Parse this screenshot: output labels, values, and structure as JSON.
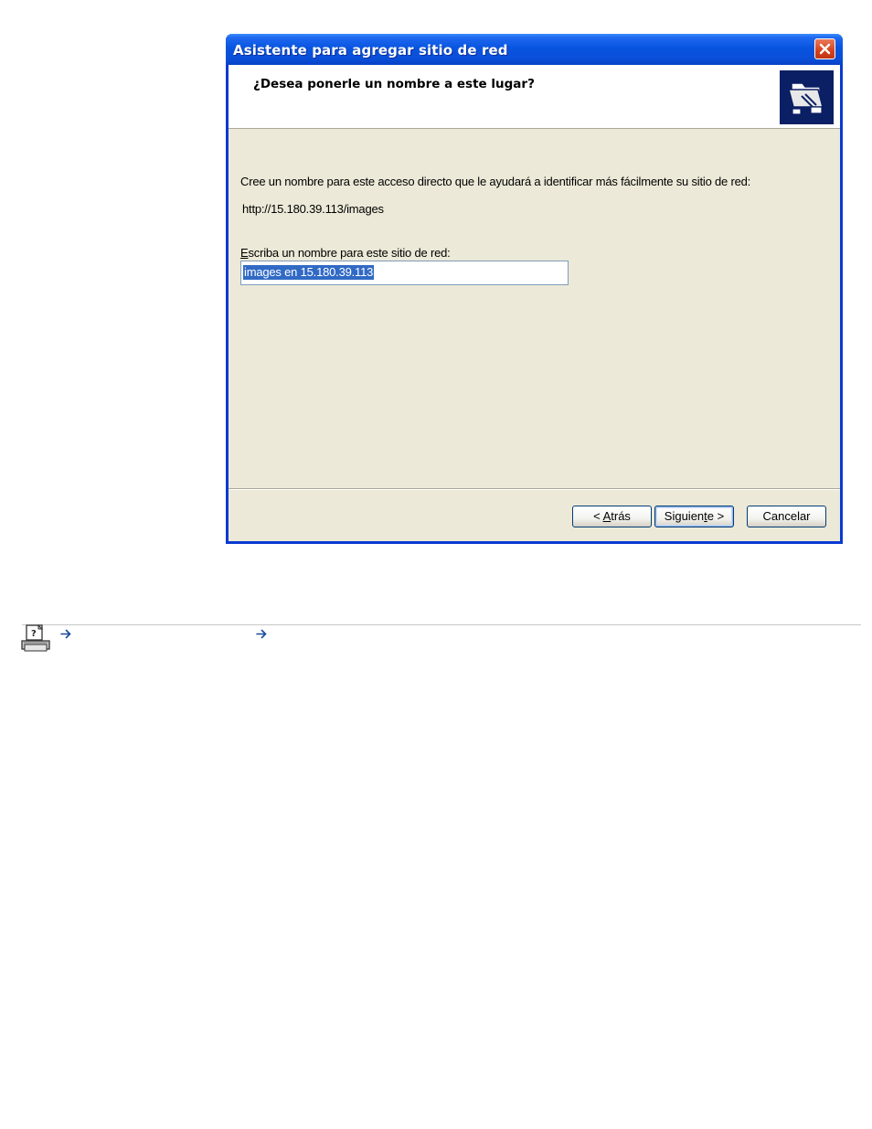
{
  "window": {
    "title": "Asistente para agregar sitio de red",
    "close_icon": "close-icon"
  },
  "header": {
    "title": "¿Desea ponerle un nombre a este lugar?",
    "icon": "network-folder-icon"
  },
  "content": {
    "description": "Cree un nombre para este acceso directo que le ayudará a identificar más fácilmente su sitio de red:",
    "url": "http://15.180.39.113/images",
    "field_label_prefix": "E",
    "field_label_rest": "scriba un nombre para este sitio de red:",
    "name_value": "images en 15.180.39.113"
  },
  "buttons": {
    "back_prefix": "< ",
    "back_mnemonic": "A",
    "back_rest": "trás",
    "next_prefix": "Siguien",
    "next_mnemonic": "t",
    "next_rest": "e >",
    "cancel_label": "Cancelar"
  },
  "footer": {
    "icons": [
      "printer-help-icon",
      "arrow-right-icon",
      "arrow-right-icon"
    ]
  },
  "colors": {
    "titlebar": "#0855e0",
    "client": "#ece9d8",
    "selection": "#316ac5",
    "close_button": "#d4411c"
  }
}
